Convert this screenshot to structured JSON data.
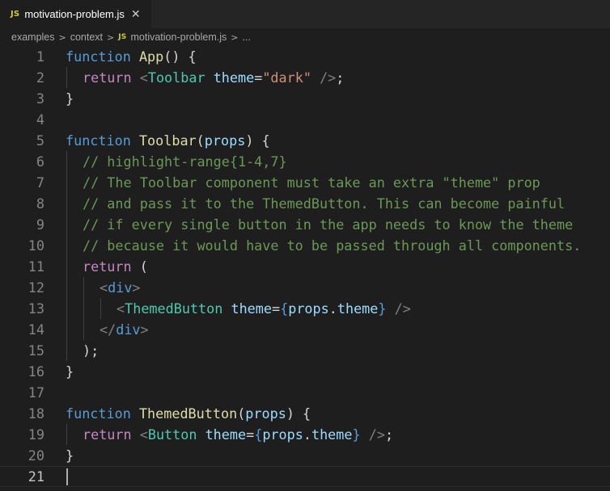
{
  "tab": {
    "badge": "JS",
    "filename": "motivation-problem.js",
    "close": "✕"
  },
  "breadcrumb": {
    "parts": [
      "examples",
      "context",
      "motivation-problem.js",
      "..."
    ],
    "separator": ">",
    "badge": "JS"
  },
  "editor": {
    "lines": [
      {
        "n": "1",
        "indent": 0,
        "tokens": [
          [
            "kw",
            "function"
          ],
          [
            "txt",
            " "
          ],
          [
            "fn",
            "App"
          ],
          [
            "txt",
            "() {"
          ]
        ]
      },
      {
        "n": "2",
        "indent": 1,
        "tokens": [
          [
            "ctl",
            "return"
          ],
          [
            "txt",
            " "
          ],
          [
            "punct",
            "<"
          ],
          [
            "tag",
            "Toolbar"
          ],
          [
            "txt",
            " "
          ],
          [
            "attr",
            "theme"
          ],
          [
            "txt",
            "="
          ],
          [
            "str",
            "\"dark\""
          ],
          [
            "txt",
            " "
          ],
          [
            "punct",
            "/>"
          ],
          [
            "txt",
            ";"
          ]
        ]
      },
      {
        "n": "3",
        "indent": 0,
        "tokens": [
          [
            "txt",
            "}"
          ]
        ]
      },
      {
        "n": "4",
        "indent": 0,
        "tokens": []
      },
      {
        "n": "5",
        "indent": 0,
        "tokens": [
          [
            "kw",
            "function"
          ],
          [
            "txt",
            " "
          ],
          [
            "fn",
            "Toolbar"
          ],
          [
            "txt",
            "("
          ],
          [
            "param",
            "props"
          ],
          [
            "txt",
            ") {"
          ]
        ]
      },
      {
        "n": "6",
        "indent": 1,
        "tokens": [
          [
            "cm",
            "// highlight-range{1-4,7}"
          ]
        ]
      },
      {
        "n": "7",
        "indent": 1,
        "tokens": [
          [
            "cm",
            "// The Toolbar component must take an extra \"theme\" prop"
          ]
        ]
      },
      {
        "n": "8",
        "indent": 1,
        "tokens": [
          [
            "cm",
            "// and pass it to the ThemedButton. This can become painful"
          ]
        ]
      },
      {
        "n": "9",
        "indent": 1,
        "tokens": [
          [
            "cm",
            "// if every single button in the app needs to know the theme"
          ]
        ]
      },
      {
        "n": "10",
        "indent": 1,
        "tokens": [
          [
            "cm",
            "// because it would have to be passed through all components."
          ]
        ]
      },
      {
        "n": "11",
        "indent": 1,
        "tokens": [
          [
            "ctl",
            "return"
          ],
          [
            "txt",
            " ("
          ]
        ]
      },
      {
        "n": "12",
        "indent": 2,
        "tokens": [
          [
            "punct",
            "<"
          ],
          [
            "tagb",
            "div"
          ],
          [
            "punct",
            ">"
          ]
        ]
      },
      {
        "n": "13",
        "indent": 3,
        "tokens": [
          [
            "punct",
            "<"
          ],
          [
            "tag",
            "ThemedButton"
          ],
          [
            "txt",
            " "
          ],
          [
            "attr",
            "theme"
          ],
          [
            "txt",
            "="
          ],
          [
            "brace",
            "{"
          ],
          [
            "param",
            "props"
          ],
          [
            "txt",
            "."
          ],
          [
            "param",
            "theme"
          ],
          [
            "brace",
            "}"
          ],
          [
            "txt",
            " "
          ],
          [
            "punct",
            "/>"
          ]
        ]
      },
      {
        "n": "14",
        "indent": 2,
        "tokens": [
          [
            "punct",
            "</"
          ],
          [
            "tagb",
            "div"
          ],
          [
            "punct",
            ">"
          ]
        ]
      },
      {
        "n": "15",
        "indent": 1,
        "tokens": [
          [
            "txt",
            ");"
          ]
        ]
      },
      {
        "n": "16",
        "indent": 0,
        "tokens": [
          [
            "txt",
            "}"
          ]
        ]
      },
      {
        "n": "17",
        "indent": 0,
        "tokens": []
      },
      {
        "n": "18",
        "indent": 0,
        "tokens": [
          [
            "kw",
            "function"
          ],
          [
            "txt",
            " "
          ],
          [
            "fn",
            "ThemedButton"
          ],
          [
            "txt",
            "("
          ],
          [
            "param",
            "props"
          ],
          [
            "txt",
            ") {"
          ]
        ]
      },
      {
        "n": "19",
        "indent": 1,
        "tokens": [
          [
            "ctl",
            "return"
          ],
          [
            "txt",
            " "
          ],
          [
            "punct",
            "<"
          ],
          [
            "tag",
            "Button"
          ],
          [
            "txt",
            " "
          ],
          [
            "attr",
            "theme"
          ],
          [
            "txt",
            "="
          ],
          [
            "brace",
            "{"
          ],
          [
            "param",
            "props"
          ],
          [
            "txt",
            "."
          ],
          [
            "param",
            "theme"
          ],
          [
            "brace",
            "}"
          ],
          [
            "txt",
            " "
          ],
          [
            "punct",
            "/>"
          ],
          [
            "txt",
            ";"
          ]
        ]
      },
      {
        "n": "20",
        "indent": 0,
        "tokens": [
          [
            "txt",
            "}"
          ]
        ]
      },
      {
        "n": "21",
        "indent": 0,
        "tokens": [],
        "active": true
      }
    ]
  },
  "colors": {
    "background": "#1e1e1e",
    "tabbar": "#252526",
    "keyword": "#569cd6",
    "control": "#c586c0",
    "function": "#dcdcaa",
    "variable": "#9cdcfe",
    "component": "#4ec9b0",
    "string": "#ce9178",
    "comment": "#6a9955"
  }
}
